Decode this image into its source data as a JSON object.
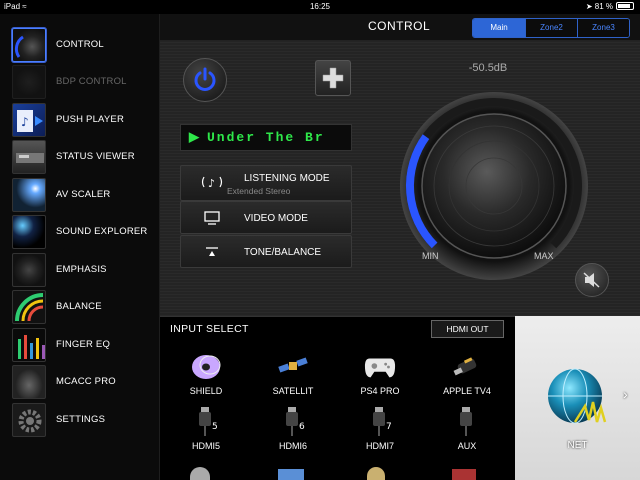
{
  "status_bar": {
    "device": "iPad",
    "time": "16:25",
    "battery": "81 %"
  },
  "sidebar": {
    "items": [
      {
        "label": "CONTROL",
        "icon": "volume-knob-icon",
        "selected": true,
        "disabled": false
      },
      {
        "label": "BDP CONTROL",
        "icon": "disc-player-icon",
        "selected": false,
        "disabled": true
      },
      {
        "label": "PUSH PLAYER",
        "icon": "music-push-icon",
        "selected": false,
        "disabled": false
      },
      {
        "label": "STATUS VIEWER",
        "icon": "receiver-status-icon",
        "selected": false,
        "disabled": false
      },
      {
        "label": "AV SCALER",
        "icon": "scaler-icon",
        "selected": false,
        "disabled": false
      },
      {
        "label": "SOUND EXPLORER",
        "icon": "speaker-explorer-icon",
        "selected": false,
        "disabled": false
      },
      {
        "label": "EMPHASIS",
        "icon": "speaker-icon",
        "selected": false,
        "disabled": false
      },
      {
        "label": "BALANCE",
        "icon": "balance-meter-icon",
        "selected": false,
        "disabled": false
      },
      {
        "label": "FINGER EQ",
        "icon": "eq-icon",
        "selected": false,
        "disabled": false
      },
      {
        "label": "MCACC PRO",
        "icon": "mcacc-icon",
        "selected": false,
        "disabled": false
      },
      {
        "label": "SETTINGS",
        "icon": "gear-icon",
        "selected": false,
        "disabled": false
      }
    ]
  },
  "header": {
    "title": "CONTROL",
    "zones": [
      {
        "label": "Main",
        "active": true
      },
      {
        "label": "Zone2",
        "active": false
      },
      {
        "label": "Zone3",
        "active": false
      }
    ]
  },
  "control": {
    "volume_text": "-50.5dB",
    "volume_level": 0.3,
    "display_text": "Under The Br",
    "modes": [
      {
        "label": "LISTENING MODE",
        "sub": "Extended Stereo",
        "icon": "music-note-icon"
      },
      {
        "label": "VIDEO MODE",
        "sub": "",
        "icon": "monitor-icon"
      },
      {
        "label": "TONE/BALANCE",
        "sub": "",
        "icon": "tone-icon"
      }
    ],
    "min_label": "MIN",
    "max_label": "MAX",
    "accent": "#2a55ff",
    "display_color": "#2ee84a"
  },
  "input_select": {
    "title": "INPUT SELECT",
    "hdmi_out_label": "HDMI OUT",
    "items": [
      {
        "label": "SHIELD",
        "icon": "disc-icon",
        "badge": ""
      },
      {
        "label": "SATELLIT",
        "icon": "satellite-icon",
        "badge": ""
      },
      {
        "label": "PS4 PRO",
        "icon": "gamepad-icon",
        "badge": ""
      },
      {
        "label": "APPLE TV4",
        "icon": "hdmi-stick-icon",
        "badge": ""
      },
      {
        "label": "HDMI5",
        "icon": "hdmi-cable-icon",
        "badge": "5"
      },
      {
        "label": "HDMI6",
        "icon": "hdmi-cable-icon",
        "badge": "6"
      },
      {
        "label": "HDMI7",
        "icon": "hdmi-cable-icon",
        "badge": "7"
      },
      {
        "label": "AUX",
        "icon": "hdmi-cable-icon",
        "badge": ""
      }
    ]
  },
  "net_panel": {
    "label": "NET",
    "icon": "globe-net-icon"
  }
}
